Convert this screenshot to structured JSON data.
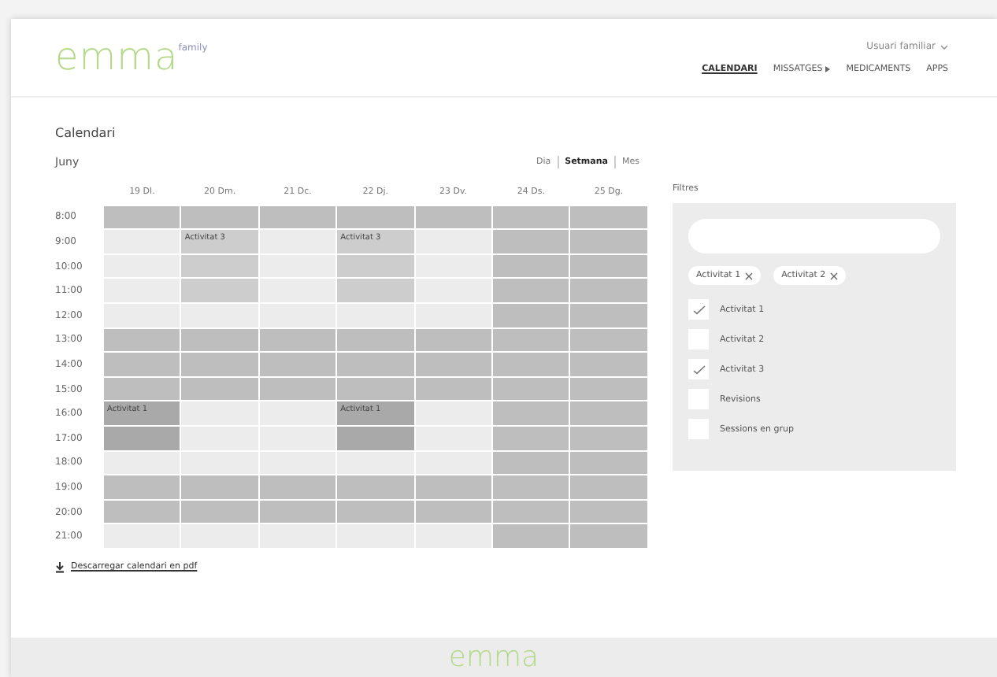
{
  "header": {
    "logo": "emma",
    "logo_tag": "family",
    "user_menu": "Usuari familiar",
    "nav": [
      {
        "label": "CALENDARI",
        "selected": true,
        "has_menu": false
      },
      {
        "label": "MISSATGES",
        "selected": false,
        "has_menu": true
      },
      {
        "label": "MEDICAMENTS",
        "selected": false,
        "has_menu": false
      },
      {
        "label": "APPS",
        "selected": false,
        "has_menu": false
      }
    ]
  },
  "page_title": "Calendari",
  "calendar": {
    "month": "Juny",
    "views": [
      {
        "label": "Dia",
        "selected": false
      },
      {
        "label": "Setmana",
        "selected": true
      },
      {
        "label": "Mes",
        "selected": false
      }
    ],
    "days": [
      "19 Dl.",
      "20 Dm.",
      "21 Dc.",
      "22 Dj.",
      "23 Dv.",
      "24 Ds.",
      "25 Dg."
    ],
    "rows": [
      {
        "time": "8:00",
        "cells": [
          {
            "kind": "busy"
          },
          {
            "kind": "busy"
          },
          {
            "kind": "busy"
          },
          {
            "kind": "busy"
          },
          {
            "kind": "busy"
          },
          {
            "kind": "busy"
          },
          {
            "kind": "busy"
          }
        ]
      },
      {
        "time": "9:00",
        "cells": [
          {
            "kind": "free"
          },
          {
            "kind": "event",
            "label": "Activitat 3"
          },
          {
            "kind": "free"
          },
          {
            "kind": "event",
            "label": "Activitat 3"
          },
          {
            "kind": "free"
          },
          {
            "kind": "busy"
          },
          {
            "kind": "busy"
          }
        ]
      },
      {
        "time": "10:00",
        "cells": [
          {
            "kind": "free"
          },
          {
            "kind": "event"
          },
          {
            "kind": "free"
          },
          {
            "kind": "event"
          },
          {
            "kind": "free"
          },
          {
            "kind": "busy"
          },
          {
            "kind": "busy"
          }
        ]
      },
      {
        "time": "11:00",
        "cells": [
          {
            "kind": "free"
          },
          {
            "kind": "event"
          },
          {
            "kind": "free"
          },
          {
            "kind": "event"
          },
          {
            "kind": "free"
          },
          {
            "kind": "busy"
          },
          {
            "kind": "busy"
          }
        ]
      },
      {
        "time": "12:00",
        "cells": [
          {
            "kind": "free"
          },
          {
            "kind": "free"
          },
          {
            "kind": "free"
          },
          {
            "kind": "free"
          },
          {
            "kind": "free"
          },
          {
            "kind": "busy"
          },
          {
            "kind": "busy"
          }
        ]
      },
      {
        "time": "13:00",
        "cells": [
          {
            "kind": "busy"
          },
          {
            "kind": "busy"
          },
          {
            "kind": "busy"
          },
          {
            "kind": "busy"
          },
          {
            "kind": "busy"
          },
          {
            "kind": "busy"
          },
          {
            "kind": "busy"
          }
        ]
      },
      {
        "time": "14:00",
        "cells": [
          {
            "kind": "busy"
          },
          {
            "kind": "busy"
          },
          {
            "kind": "busy"
          },
          {
            "kind": "busy"
          },
          {
            "kind": "busy"
          },
          {
            "kind": "busy"
          },
          {
            "kind": "busy"
          }
        ]
      },
      {
        "time": "15:00",
        "cells": [
          {
            "kind": "busy"
          },
          {
            "kind": "busy"
          },
          {
            "kind": "busy"
          },
          {
            "kind": "busy"
          },
          {
            "kind": "busy"
          },
          {
            "kind": "busy"
          },
          {
            "kind": "busy"
          }
        ]
      },
      {
        "time": "16:00",
        "cells": [
          {
            "kind": "highlight",
            "label": "Activitat 1"
          },
          {
            "kind": "free"
          },
          {
            "kind": "free"
          },
          {
            "kind": "highlight",
            "label": "Activitat 1"
          },
          {
            "kind": "free"
          },
          {
            "kind": "busy"
          },
          {
            "kind": "busy"
          }
        ]
      },
      {
        "time": "17:00",
        "cells": [
          {
            "kind": "highlight"
          },
          {
            "kind": "free"
          },
          {
            "kind": "free"
          },
          {
            "kind": "highlight"
          },
          {
            "kind": "free"
          },
          {
            "kind": "busy"
          },
          {
            "kind": "busy"
          }
        ]
      },
      {
        "time": "18:00",
        "cells": [
          {
            "kind": "free"
          },
          {
            "kind": "free"
          },
          {
            "kind": "free"
          },
          {
            "kind": "free"
          },
          {
            "kind": "free"
          },
          {
            "kind": "busy"
          },
          {
            "kind": "busy"
          }
        ]
      },
      {
        "time": "19:00",
        "cells": [
          {
            "kind": "busy"
          },
          {
            "kind": "busy"
          },
          {
            "kind": "busy"
          },
          {
            "kind": "busy"
          },
          {
            "kind": "busy"
          },
          {
            "kind": "busy"
          },
          {
            "kind": "busy"
          }
        ]
      },
      {
        "time": "20:00",
        "cells": [
          {
            "kind": "busy"
          },
          {
            "kind": "busy"
          },
          {
            "kind": "busy"
          },
          {
            "kind": "busy"
          },
          {
            "kind": "busy"
          },
          {
            "kind": "busy"
          },
          {
            "kind": "busy"
          }
        ]
      },
      {
        "time": "21:00",
        "cells": [
          {
            "kind": "free"
          },
          {
            "kind": "free"
          },
          {
            "kind": "free"
          },
          {
            "kind": "free"
          },
          {
            "kind": "free"
          },
          {
            "kind": "busy"
          },
          {
            "kind": "busy"
          }
        ]
      }
    ],
    "download_link": "Descarregar calendari en pdf"
  },
  "filters": {
    "title": "Filtres",
    "chips": [
      {
        "label": "Activitat 1"
      },
      {
        "label": "Activitat 2"
      }
    ],
    "options": [
      {
        "label": "Activitat 1",
        "checked": true
      },
      {
        "label": "Activitat 2",
        "checked": false
      },
      {
        "label": "Activitat 3",
        "checked": true
      },
      {
        "label": "Revisions",
        "checked": false
      },
      {
        "label": "Sessions en grup",
        "checked": false
      }
    ]
  },
  "footer": {
    "logo": "emma"
  }
}
